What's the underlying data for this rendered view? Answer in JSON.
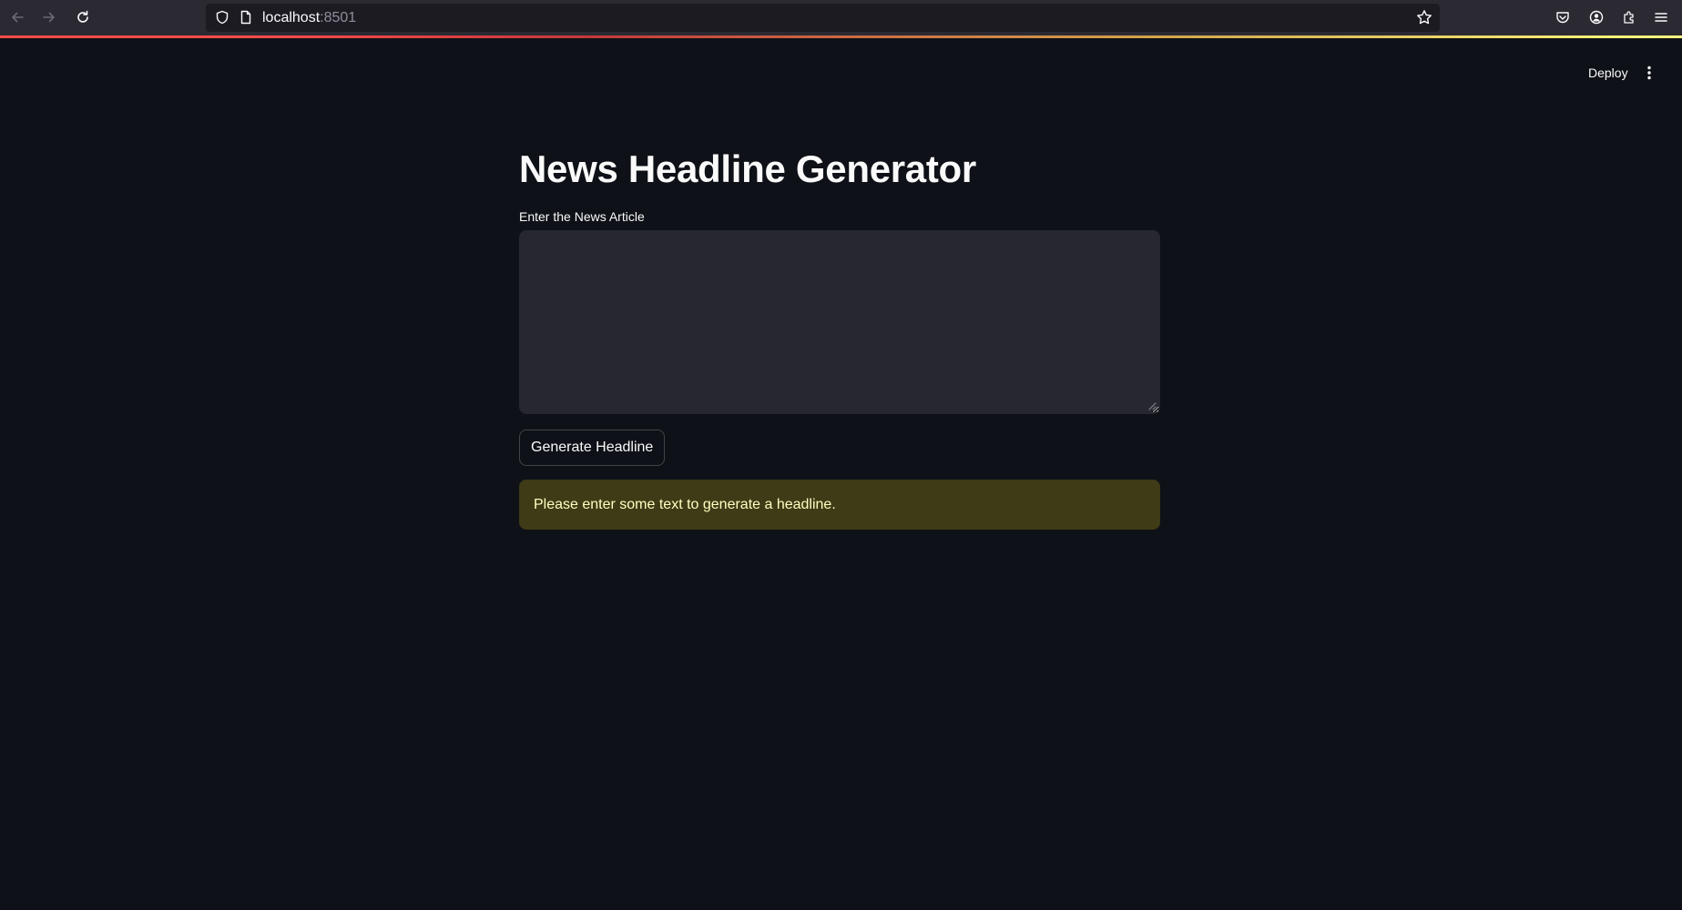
{
  "browser": {
    "url_host": "localhost",
    "url_port": ":8501",
    "icons": {
      "back": "arrow-left-icon",
      "forward": "arrow-right-icon",
      "reload": "reload-icon",
      "shield": "shield-icon",
      "page": "page-icon",
      "bookmark": "star-icon",
      "pocket": "pocket-icon",
      "account": "account-icon",
      "extensions": "puzzle-icon",
      "menu": "hamburger-menu-icon"
    }
  },
  "header": {
    "deploy_label": "Deploy",
    "menu_icon": "kebab-menu-icon"
  },
  "main": {
    "title": "News Headline Generator",
    "input_label": "Enter the News Article",
    "input_value": "",
    "button_label": "Generate Headline",
    "warning_text": "Please enter some text to generate a headline."
  },
  "colors": {
    "background": "#0e1117",
    "textarea_bg": "#262730",
    "warning_bg": "#3e3b16",
    "warning_text": "#ffffc2",
    "text": "#fafafa"
  }
}
